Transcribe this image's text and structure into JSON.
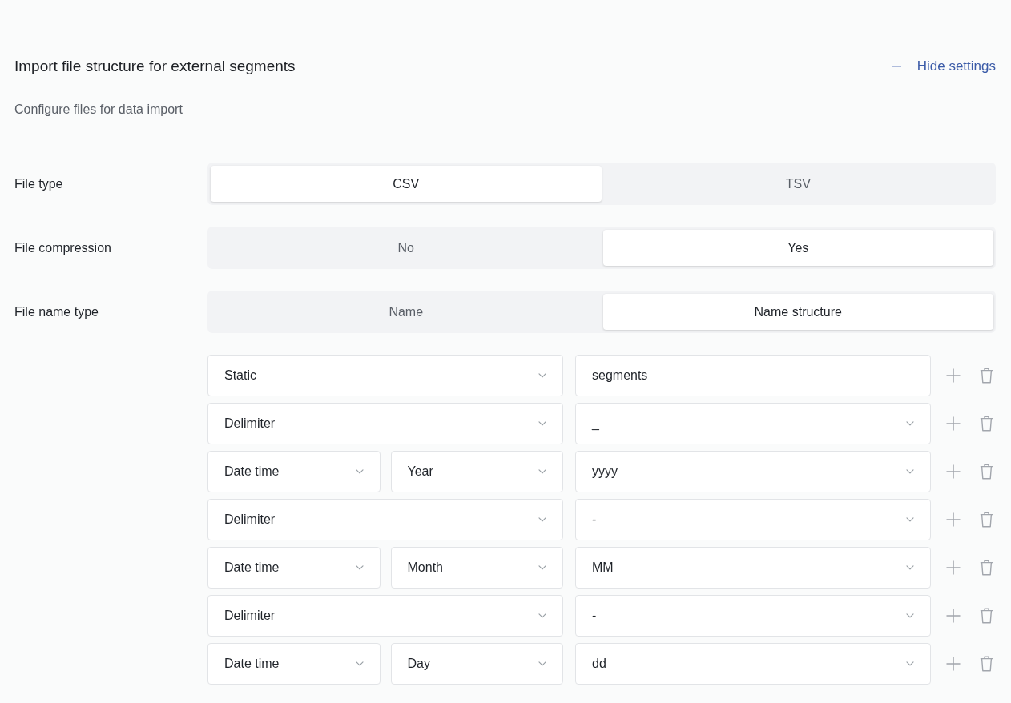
{
  "header": {
    "title": "Import file structure for external segments",
    "subtitle": "Configure files for data import",
    "toggle_label": "Hide settings"
  },
  "settings": [
    {
      "label": "File type",
      "options": [
        {
          "label": "CSV",
          "selected": true
        },
        {
          "label": "TSV",
          "selected": false
        }
      ]
    },
    {
      "label": "File compression",
      "options": [
        {
          "label": "No",
          "selected": false
        },
        {
          "label": "Yes",
          "selected": true
        }
      ]
    },
    {
      "label": "File name type",
      "options": [
        {
          "label": "Name",
          "selected": false
        },
        {
          "label": "Name structure",
          "selected": true
        }
      ]
    }
  ],
  "name_structure": [
    {
      "type": "Static",
      "value": {
        "kind": "input",
        "text": "segments"
      }
    },
    {
      "type": "Delimiter",
      "value": {
        "kind": "select",
        "text": "_"
      }
    },
    {
      "type": "Date time",
      "unit": "Year",
      "value": {
        "kind": "select",
        "text": "yyyy"
      }
    },
    {
      "type": "Delimiter",
      "value": {
        "kind": "select",
        "text": "-"
      }
    },
    {
      "type": "Date time",
      "unit": "Month",
      "value": {
        "kind": "select",
        "text": "MM"
      }
    },
    {
      "type": "Delimiter",
      "value": {
        "kind": "select",
        "text": "-"
      }
    },
    {
      "type": "Date time",
      "unit": "Day",
      "value": {
        "kind": "select",
        "text": "dd"
      }
    }
  ]
}
